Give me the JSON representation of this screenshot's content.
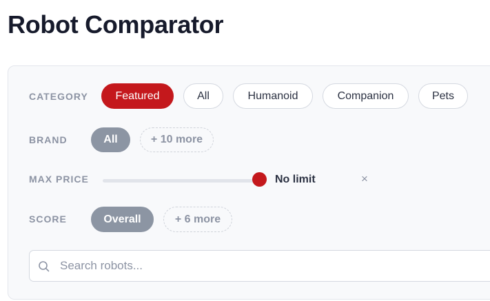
{
  "page": {
    "title": "Robot Comparator"
  },
  "filters": {
    "category": {
      "label": "CATEGORY",
      "chips": [
        "Featured",
        "All",
        "Humanoid",
        "Companion",
        "Pets"
      ],
      "selected": "Featured"
    },
    "brand": {
      "label": "BRAND",
      "chips": [
        "All"
      ],
      "selected": "All",
      "more_label": "+ 10 more"
    },
    "max_price": {
      "label": "MAX PRICE",
      "value_label": "No limit",
      "level": 1.0,
      "clear_glyph": "×"
    },
    "score": {
      "label": "SCORE",
      "chips": [
        "Overall"
      ],
      "selected": "Overall",
      "more_label": "+ 6 more"
    }
  },
  "search": {
    "value": "",
    "placeholder": "Search robots..."
  },
  "colors": {
    "accent": "#c4181c",
    "chip_selected_neutral": "#8c95a3",
    "label_gray": "#8c93a3",
    "panel_bg": "#f8f9fb"
  }
}
